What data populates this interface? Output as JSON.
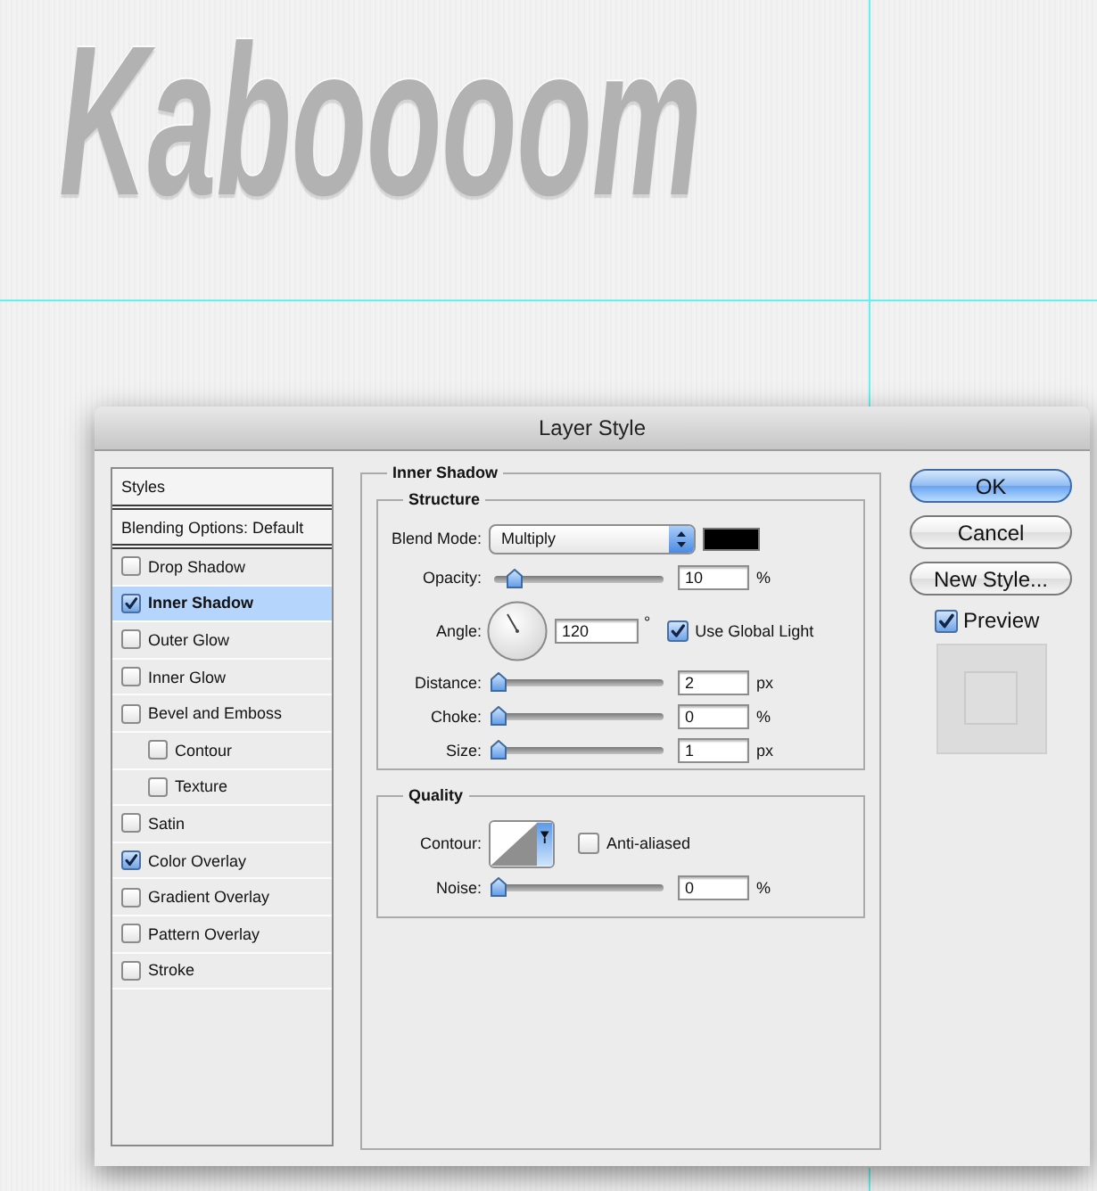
{
  "canvas": {
    "artwork_text": "Kaboooom"
  },
  "dialog": {
    "title": "Layer Style",
    "styles_list": {
      "header": "Styles",
      "items": [
        {
          "kind": "options",
          "label": "Blending Options: Default",
          "selected": false
        },
        {
          "kind": "effect",
          "label": "Drop Shadow",
          "checked": false,
          "selected": false
        },
        {
          "kind": "effect",
          "label": "Inner Shadow",
          "checked": true,
          "selected": true
        },
        {
          "kind": "effect",
          "label": "Outer Glow",
          "checked": false,
          "selected": false
        },
        {
          "kind": "effect",
          "label": "Inner Glow",
          "checked": false,
          "selected": false
        },
        {
          "kind": "effect",
          "label": "Bevel and Emboss",
          "checked": false,
          "selected": false,
          "children": [
            {
              "kind": "effect",
              "label": "Contour",
              "checked": false,
              "selected": false
            },
            {
              "kind": "effect",
              "label": "Texture",
              "checked": false,
              "selected": false
            }
          ]
        },
        {
          "kind": "effect",
          "label": "Satin",
          "checked": false,
          "selected": false
        },
        {
          "kind": "effect",
          "label": "Color Overlay",
          "checked": true,
          "selected": false
        },
        {
          "kind": "effect",
          "label": "Gradient Overlay",
          "checked": false,
          "selected": false
        },
        {
          "kind": "effect",
          "label": "Pattern Overlay",
          "checked": false,
          "selected": false
        },
        {
          "kind": "effect",
          "label": "Stroke",
          "checked": false,
          "selected": false
        }
      ]
    },
    "effect_panel": {
      "title": "Inner Shadow",
      "structure": {
        "title": "Structure",
        "rows": [
          {
            "kind": "dropdown",
            "label": "Blend Mode:",
            "value": "Multiply",
            "color": "#000000"
          },
          {
            "kind": "slider",
            "label": "Opacity:",
            "level": 0.1,
            "value": "10",
            "unit": "%"
          },
          {
            "kind": "angle",
            "label": "Angle:",
            "value": "120",
            "unit": "°",
            "checkbox": {
              "label": "Use Global Light",
              "checked": true
            }
          },
          {
            "kind": "slider",
            "label": "Distance:",
            "level": 0,
            "value": "2",
            "unit": "px"
          },
          {
            "kind": "slider",
            "label": "Choke:",
            "level": 0,
            "value": "0",
            "unit": "%"
          },
          {
            "kind": "slider",
            "label": "Size:",
            "level": 0,
            "value": "1",
            "unit": "px"
          }
        ]
      },
      "quality": {
        "title": "Quality",
        "rows": [
          {
            "kind": "contour",
            "label": "Contour:",
            "checkbox": {
              "label": "Anti-aliased",
              "checked": false
            }
          },
          {
            "kind": "slider",
            "label": "Noise:",
            "level": 0,
            "value": "0",
            "unit": "%"
          }
        ]
      }
    },
    "buttons": [
      {
        "label": "OK",
        "default": true
      },
      {
        "label": "Cancel",
        "default": false
      },
      {
        "label": "New Style...",
        "default": false
      }
    ],
    "preview": {
      "label": "Preview",
      "checked": true
    }
  }
}
